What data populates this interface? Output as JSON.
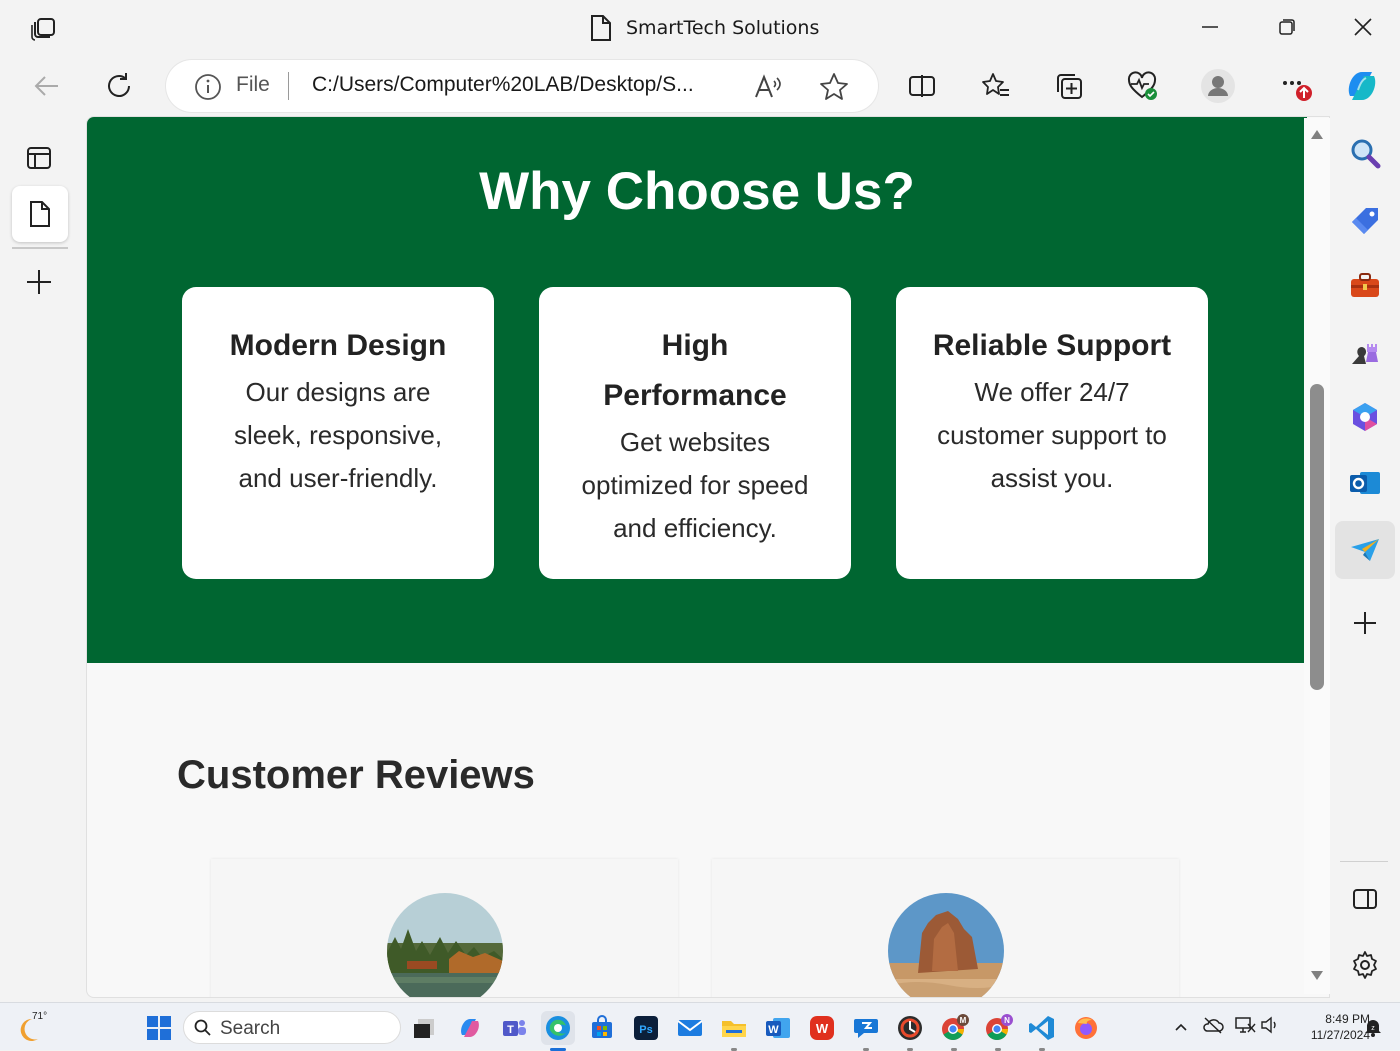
{
  "window": {
    "title": "SmartTech Solutions"
  },
  "address_bar": {
    "scheme_label": "File",
    "url": "C:/Users/Computer%20LAB/Desktop/S..."
  },
  "page": {
    "hero": {
      "title": "Why Choose Us?",
      "background": "#006631"
    },
    "features": [
      {
        "title": "Modern Design",
        "text": "Our designs are sleek, responsive, and user-friendly."
      },
      {
        "title": "High Performance",
        "text": "Get websites optimized for speed and efficiency."
      },
      {
        "title": "Reliable Support",
        "text": "We offer 24/7 customer support to assist you."
      }
    ],
    "reviews": {
      "title": "Customer Reviews",
      "items": [
        {
          "photo": "lake-forest-photo"
        },
        {
          "photo": "desert-rock-photo"
        }
      ]
    }
  },
  "right_sidebar": {
    "items": [
      "search-icon",
      "tag-icon",
      "toolbox-icon",
      "chess-icon",
      "copilot-icon",
      "outlook-icon",
      "send-icon",
      "add-icon"
    ],
    "bottom": [
      "sidebar-toggle-icon",
      "settings-icon"
    ]
  },
  "taskbar": {
    "weather": "71°",
    "search_placeholder": "Search",
    "time": "8:49 PM",
    "date": "11/27/2024"
  }
}
